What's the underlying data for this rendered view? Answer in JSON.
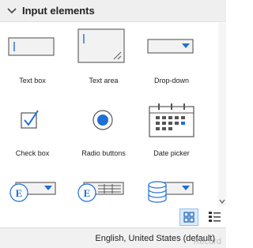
{
  "header": {
    "title": "Input elements",
    "icon": "chevron-down-icon"
  },
  "items": [
    {
      "label": "Text box",
      "icon": "text-box-icon"
    },
    {
      "label": "Text area",
      "icon": "text-area-icon"
    },
    {
      "label": "Drop-down",
      "icon": "drop-down-icon"
    },
    {
      "label": "Check box",
      "icon": "check-box-icon"
    },
    {
      "label": "Radio buttons",
      "icon": "radio-buttons-icon"
    },
    {
      "label": "Date picker",
      "icon": "date-picker-icon"
    },
    {
      "label": "",
      "icon": "expression-dropdown-icon"
    },
    {
      "label": "",
      "icon": "expression-list-icon"
    },
    {
      "label": "",
      "icon": "database-dropdown-icon"
    }
  ],
  "view": {
    "grid_icon": "grid-view-icon",
    "list_icon": "list-view-icon",
    "active": "grid"
  },
  "status": {
    "language": "English, United States (default)",
    "watermark": "Record"
  },
  "colors": {
    "accent": "#1f6fd6",
    "header_bg": "#efeff0",
    "status_bg": "#f1f1f1",
    "active_view_bg": "#dcebfa"
  }
}
